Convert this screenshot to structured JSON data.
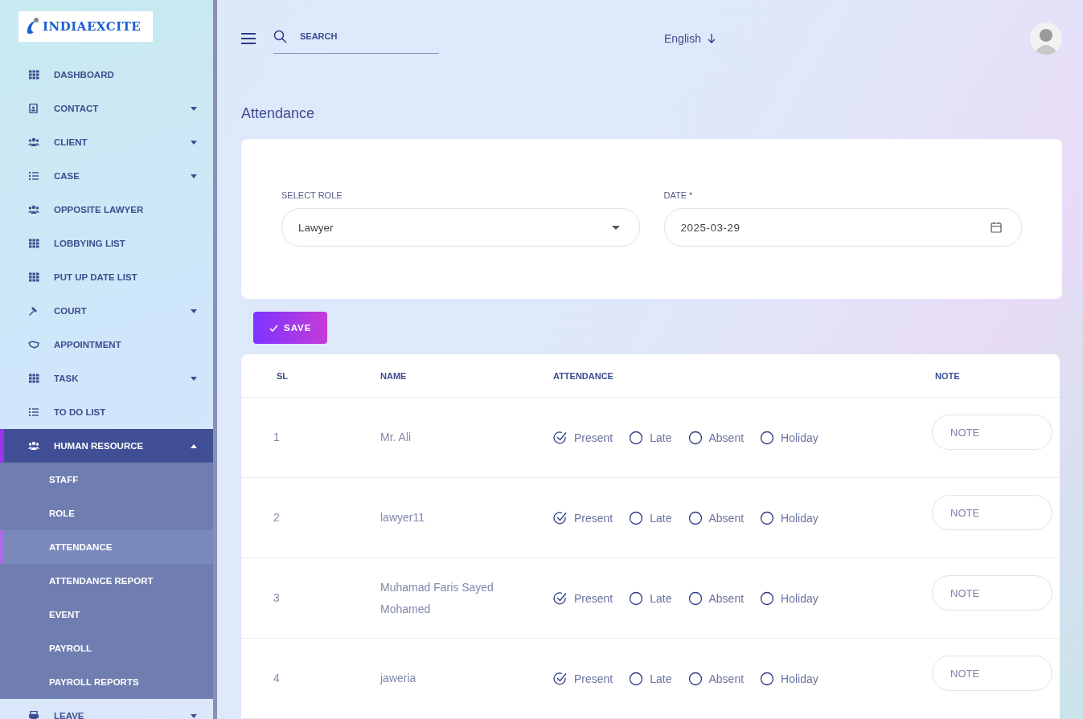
{
  "logo": {
    "text": "INDIAEXCITE"
  },
  "sidebar": {
    "items": [
      {
        "label": "DASHBOARD",
        "expandable": false,
        "selected": false
      },
      {
        "label": "CONTACT",
        "expandable": true,
        "expanded": false,
        "selected": false
      },
      {
        "label": "CLIENT",
        "expandable": true,
        "expanded": false,
        "selected": false
      },
      {
        "label": "CASE",
        "expandable": true,
        "expanded": false,
        "selected": false
      },
      {
        "label": "OPPOSITE LAWYER",
        "expandable": false,
        "selected": false
      },
      {
        "label": "LOBBYING LIST",
        "expandable": false,
        "selected": false
      },
      {
        "label": "PUT UP DATE LIST",
        "expandable": false,
        "selected": false
      },
      {
        "label": "COURT",
        "expandable": true,
        "expanded": false,
        "selected": false
      },
      {
        "label": "APPOINTMENT",
        "expandable": false,
        "selected": false
      },
      {
        "label": "TASK",
        "expandable": true,
        "expanded": false,
        "selected": false
      },
      {
        "label": "TO DO LIST",
        "expandable": false,
        "selected": false
      },
      {
        "label": "HUMAN RESOURCE",
        "expandable": true,
        "expanded": true,
        "selected": true,
        "children": [
          {
            "label": "STAFF",
            "selected": false
          },
          {
            "label": "ROLE",
            "selected": false
          },
          {
            "label": "ATTENDANCE",
            "selected": true
          },
          {
            "label": "ATTENDANCE REPORT",
            "selected": false
          },
          {
            "label": "EVENT",
            "selected": false
          },
          {
            "label": "PAYROLL",
            "selected": false
          },
          {
            "label": "PAYROLL REPORTS",
            "selected": false
          }
        ]
      },
      {
        "label": "LEAVE",
        "expandable": true,
        "expanded": false,
        "selected": false
      }
    ]
  },
  "topbar": {
    "search": {
      "placeholder": "SEARCH"
    },
    "language": "English"
  },
  "page_title": "Attendance",
  "filters": {
    "role": {
      "label": "SELECT ROLE",
      "value": "Lawyer"
    },
    "date": {
      "label": "DATE *",
      "value": "2025-03-29"
    }
  },
  "save_button": "SAVE",
  "table": {
    "columns": [
      "SL",
      "NAME",
      "ATTENDANCE",
      "NOTE"
    ],
    "rows": [
      {
        "sl": "1",
        "name": "Mr. Ali",
        "options": [
          {
            "label": "Present",
            "selected": true
          },
          {
            "label": "Late",
            "selected": false
          },
          {
            "label": "Absent",
            "selected": false
          },
          {
            "label": "Holiday",
            "selected": false
          }
        ],
        "note": {
          "placeholder": "NOTE"
        }
      },
      {
        "sl": "2",
        "name": "lawyer11",
        "options": [
          {
            "label": "Present",
            "selected": true
          },
          {
            "label": "Late",
            "selected": false
          },
          {
            "label": "Absent",
            "selected": false
          },
          {
            "label": "Holiday",
            "selected": false
          }
        ],
        "note": {
          "placeholder": "NOTE"
        }
      },
      {
        "sl": "3",
        "name": "Muhamad Faris Sayed Mohamed",
        "options": [
          {
            "label": "Present",
            "selected": true
          },
          {
            "label": "Late",
            "selected": false
          },
          {
            "label": "Absent",
            "selected": false
          },
          {
            "label": "Holiday",
            "selected": false
          }
        ],
        "note": {
          "placeholder": "NOTE"
        }
      },
      {
        "sl": "4",
        "name": "jaweria",
        "options": [
          {
            "label": "Present",
            "selected": true
          },
          {
            "label": "Late",
            "selected": false
          },
          {
            "label": "Absent",
            "selected": false
          },
          {
            "label": "Holiday",
            "selected": false
          }
        ],
        "note": {
          "placeholder": "NOTE"
        }
      }
    ]
  }
}
